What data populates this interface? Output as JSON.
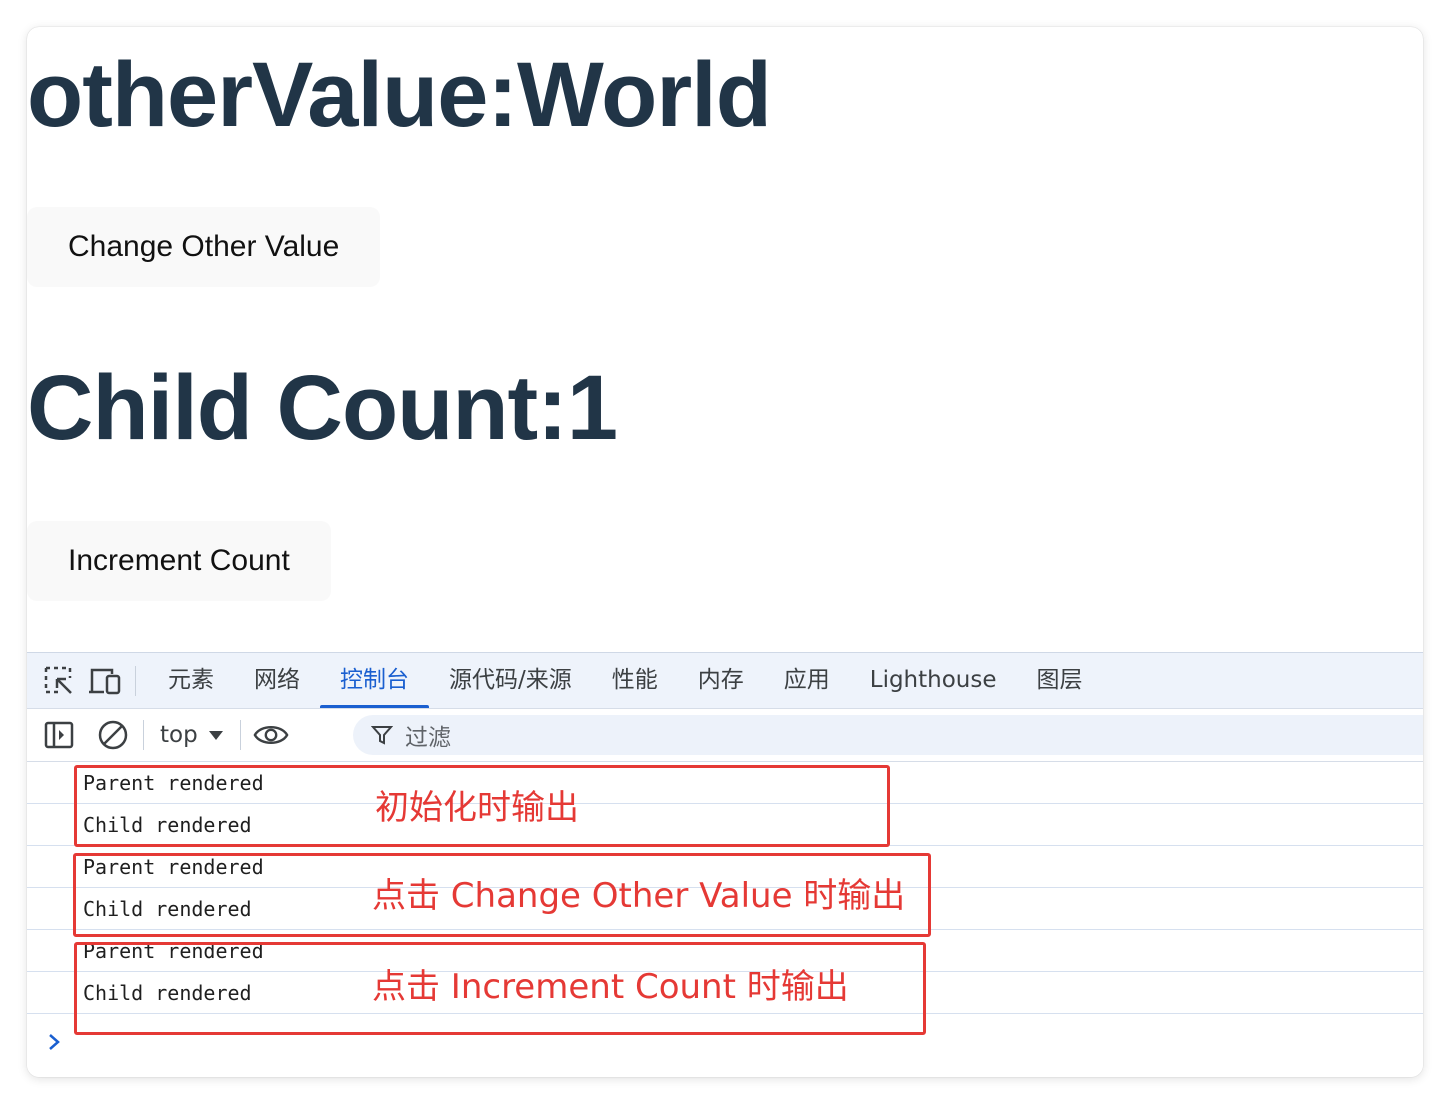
{
  "page": {
    "other_value_heading": "otherValue:World",
    "change_button_label": "Change Other Value",
    "count_heading": "Child Count:1",
    "increment_button_label": "Increment Count"
  },
  "devtools": {
    "tabs": [
      {
        "label": "元素"
      },
      {
        "label": "网络"
      },
      {
        "label": "控制台",
        "active": true
      },
      {
        "label": "源代码/来源"
      },
      {
        "label": "性能"
      },
      {
        "label": "内存"
      },
      {
        "label": "应用"
      },
      {
        "label": "Lighthouse"
      },
      {
        "label": "图层"
      }
    ],
    "context": "top",
    "filter_placeholder": "过滤",
    "logs": [
      "Parent rendered",
      "Child rendered",
      "Parent rendered",
      "Child rendered",
      "Parent rendered",
      "Child rendered"
    ]
  },
  "annotations": [
    "初始化时输出",
    "点击 Change Other Value  时输出",
    "点击 Increment Count  时输出"
  ],
  "colors": {
    "heading": "#213547",
    "active_tab": "#1a5fd0",
    "annotation": "#e53935"
  }
}
